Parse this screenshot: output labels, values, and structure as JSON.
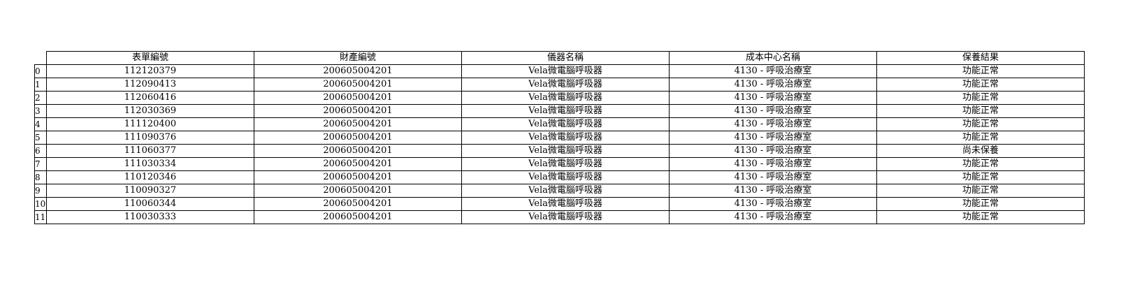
{
  "table": {
    "columns": [
      "表單編號",
      "財產編號",
      "儀器名稱",
      "成本中心名稱",
      "保養結果"
    ],
    "rows": [
      {
        "index": "0",
        "cells": [
          "112120379",
          "200605004201",
          "Vela微電腦呼吸器",
          "4130 - 呼吸治療室",
          "功能正常"
        ]
      },
      {
        "index": "1",
        "cells": [
          "112090413",
          "200605004201",
          "Vela微電腦呼吸器",
          "4130 - 呼吸治療室",
          "功能正常"
        ]
      },
      {
        "index": "2",
        "cells": [
          "112060416",
          "200605004201",
          "Vela微電腦呼吸器",
          "4130 - 呼吸治療室",
          "功能正常"
        ]
      },
      {
        "index": "3",
        "cells": [
          "112030369",
          "200605004201",
          "Vela微電腦呼吸器",
          "4130 - 呼吸治療室",
          "功能正常"
        ]
      },
      {
        "index": "4",
        "cells": [
          "111120400",
          "200605004201",
          "Vela微電腦呼吸器",
          "4130 - 呼吸治療室",
          "功能正常"
        ]
      },
      {
        "index": "5",
        "cells": [
          "111090376",
          "200605004201",
          "Vela微電腦呼吸器",
          "4130 - 呼吸治療室",
          "功能正常"
        ]
      },
      {
        "index": "6",
        "cells": [
          "111060377",
          "200605004201",
          "Vela微電腦呼吸器",
          "4130 - 呼吸治療室",
          "尚未保養"
        ]
      },
      {
        "index": "7",
        "cells": [
          "111030334",
          "200605004201",
          "Vela微電腦呼吸器",
          "4130 - 呼吸治療室",
          "功能正常"
        ]
      },
      {
        "index": "8",
        "cells": [
          "110120346",
          "200605004201",
          "Vela微電腦呼吸器",
          "4130 - 呼吸治療室",
          "功能正常"
        ]
      },
      {
        "index": "9",
        "cells": [
          "110090327",
          "200605004201",
          "Vela微電腦呼吸器",
          "4130 - 呼吸治療室",
          "功能正常"
        ]
      },
      {
        "index": "10",
        "cells": [
          "110060344",
          "200605004201",
          "Vela微電腦呼吸器",
          "4130 - 呼吸治療室",
          "功能正常"
        ]
      },
      {
        "index": "11",
        "cells": [
          "110030333",
          "200605004201",
          "Vela微電腦呼吸器",
          "4130 - 呼吸治療室",
          "功能正常"
        ]
      }
    ]
  }
}
